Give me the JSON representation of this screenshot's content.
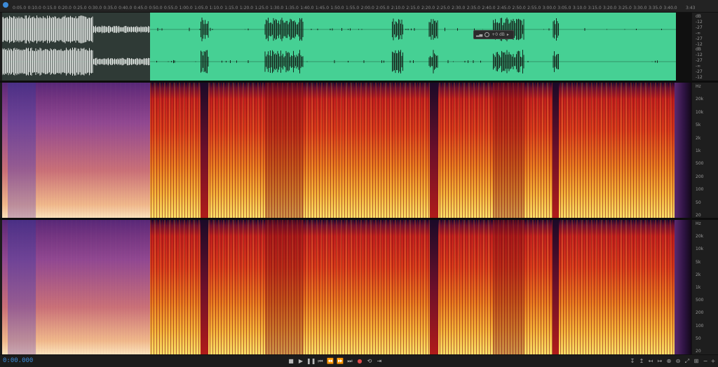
{
  "ruler": {
    "ticks": [
      "0:05.0",
      "0:10.0",
      "0:15.0",
      "0:20.0",
      "0:25.0",
      "0:30.0",
      "0:35.0",
      "0:40.0",
      "0:45.0",
      "0:50.0",
      "0:55.0",
      "1:00.0",
      "1:05.0",
      "1:10.0",
      "1:15.0",
      "1:20.0",
      "1:25.0",
      "1:30.0",
      "1:35.0",
      "1:40.0",
      "1:45.0",
      "1:50.0",
      "1:55.0",
      "2:00.0",
      "2:05.0",
      "2:10.0",
      "2:15.0",
      "2:20.0",
      "2:25.0",
      "2:30.0",
      "2:35.0",
      "2:40.0",
      "2:45.0",
      "2:50.0",
      "2:55.0",
      "3:00.0",
      "3:05.0",
      "3:10.0",
      "3:15.0",
      "3:20.0",
      "3:25.0",
      "3:30.0",
      "3:35.0",
      "3:40.0"
    ],
    "end_label": "3:43"
  },
  "hud": {
    "gain": "+0 dB"
  },
  "amplitude_scale": [
    "dB",
    "-12",
    "-27",
    "-∞",
    "-27",
    "-12",
    "dB",
    "-12",
    "-27",
    "-∞",
    "-27",
    "-12"
  ],
  "freq_scale_top": [
    "Hz",
    "20k",
    "10k",
    "5k",
    "2k",
    "1k",
    "500",
    "200",
    "100",
    "50",
    "20"
  ],
  "freq_scale_bottom": [
    "Hz",
    "20k",
    "10k",
    "5k",
    "2k",
    "1k",
    "500",
    "200",
    "100",
    "50",
    "20"
  ],
  "transport": {
    "timecode": "0:00.000",
    "stop": "■",
    "play": "▶",
    "pause": "❚❚",
    "to_start": "⏮",
    "rewind": "⏪",
    "fast_forward": "⏩",
    "to_end": "⏭",
    "record": "●",
    "loop": "⟲",
    "skip": "⇥"
  },
  "zoom": {
    "zoom_in_amp": "⊕",
    "zoom_out_amp": "⊖",
    "zoom_in_time": "+",
    "zoom_out_time": "−",
    "zoom_full": "⤢",
    "zoom_sel": "⊞",
    "zoom_in_a": "↧",
    "zoom_in_b": "↥",
    "zoom_out_a": "↤",
    "zoom_out_b": "↦"
  },
  "colors": {
    "waveform": "#46d094",
    "accent": "#3d8bd8",
    "record": "#e24a4a"
  }
}
